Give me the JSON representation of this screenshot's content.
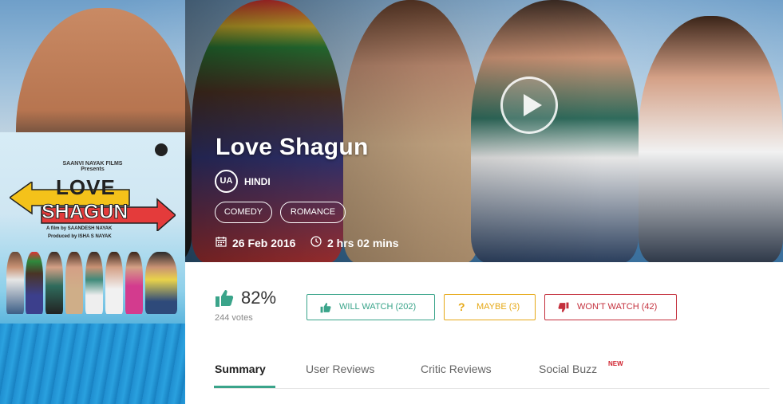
{
  "movie": {
    "title": "Love Shagun",
    "certification": "UA",
    "language": "HINDI",
    "genres": [
      "COMEDY",
      "ROMANCE"
    ],
    "release_date": "26 Feb 2016",
    "duration": "2 hrs 02 mins"
  },
  "poster": {
    "presents_line1": "SAANVI NAYAK FILMS",
    "presents_line2": "Presents",
    "title_line1": "LOVE",
    "title_line2": "SHAGUN",
    "credit_director": "A film by SAANDESH NAYAK",
    "credit_producer": "Produced by ISHA S NAYAK"
  },
  "rating": {
    "percent": "82%",
    "votes": "244 votes"
  },
  "vote_buttons": {
    "will_watch": "WILL WATCH (202)",
    "maybe": "MAYBE (3)",
    "wont_watch": "WON'T WATCH (42)"
  },
  "tabs": [
    {
      "label": "Summary",
      "active": true
    },
    {
      "label": "User Reviews",
      "active": false
    },
    {
      "label": "Critic Reviews",
      "active": false
    },
    {
      "label": "Social Buzz",
      "active": false,
      "badge": "NEW"
    }
  ],
  "colors": {
    "accent_green": "#3aa48a",
    "maybe_yellow": "#e6a816",
    "wont_red": "#c4303d",
    "new_badge_red": "#d0222e"
  },
  "icons": {
    "play": "play-icon",
    "calendar": "calendar-icon",
    "clock": "clock-icon",
    "thumbs_up": "thumbs-up-icon",
    "question": "question-icon",
    "thumbs_down": "thumbs-down-icon"
  }
}
